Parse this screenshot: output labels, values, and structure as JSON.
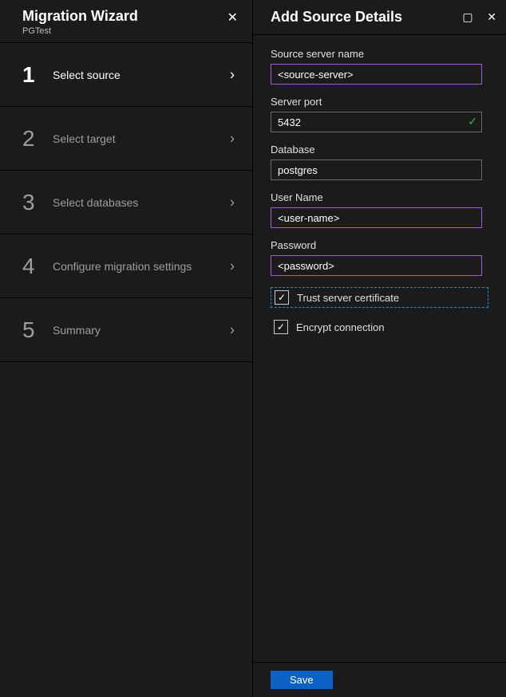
{
  "wizard": {
    "title": "Migration Wizard",
    "subtitle": "PGTest",
    "steps": [
      {
        "num": "1",
        "label": "Select source",
        "active": true
      },
      {
        "num": "2",
        "label": "Select target",
        "active": false
      },
      {
        "num": "3",
        "label": "Select databases",
        "active": false
      },
      {
        "num": "4",
        "label": "Configure migration settings",
        "active": false
      },
      {
        "num": "5",
        "label": "Summary",
        "active": false
      }
    ]
  },
  "details": {
    "title": "Add Source Details",
    "fields": {
      "server_name": {
        "label": "Source server name",
        "value": "<source-server>"
      },
      "server_port": {
        "label": "Server port",
        "value": "5432",
        "validated": true
      },
      "database": {
        "label": "Database",
        "value": "postgres"
      },
      "user_name": {
        "label": "User Name",
        "value": "<user-name>"
      },
      "password": {
        "label": "Password",
        "value": "<password>"
      }
    },
    "checkboxes": {
      "trust": {
        "label": "Trust server certificate",
        "checked": true,
        "focused": true
      },
      "encrypt": {
        "label": "Encrypt connection",
        "checked": true,
        "focused": false
      }
    },
    "save_label": "Save"
  }
}
